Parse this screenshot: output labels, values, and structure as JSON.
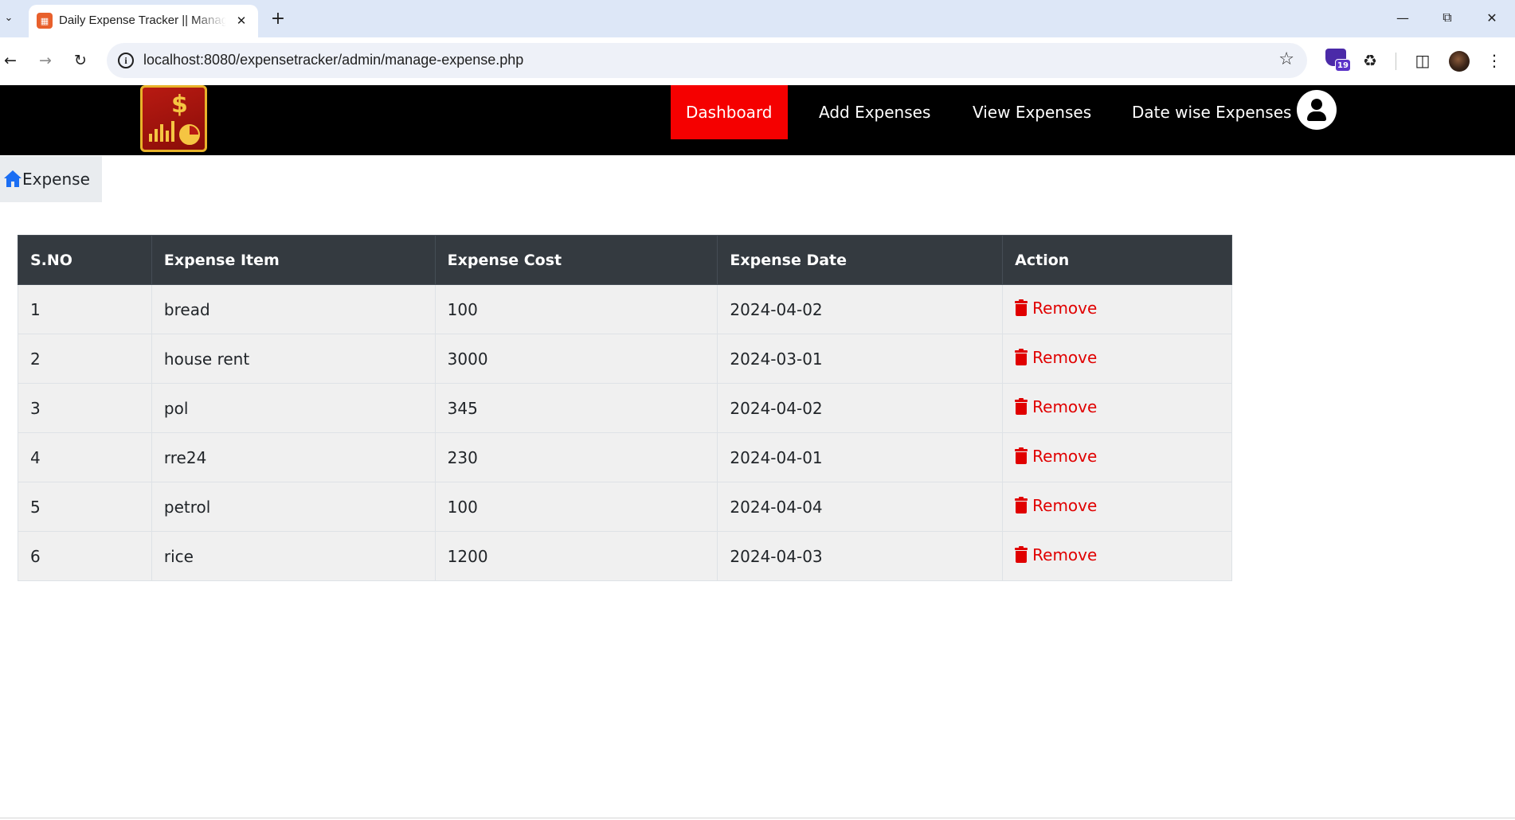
{
  "browser": {
    "tab_title": "Daily Expense Tracker || Manage Expense",
    "url": "localhost:8080/expensetracker/admin/manage-expense.php",
    "extension_badge": "19",
    "icons": [
      "tab-list-icon",
      "close-icon",
      "plus-icon",
      "minimize-icon",
      "restore-icon",
      "back-icon",
      "forward-icon",
      "reload-icon",
      "info-icon",
      "star-icon",
      "extensions-icon",
      "side-panel-icon",
      "more-icon"
    ]
  },
  "navbar": {
    "items": [
      {
        "label": "Dashboard",
        "active": true
      },
      {
        "label": "Add Expenses",
        "active": false
      },
      {
        "label": "View Expenses",
        "active": false
      },
      {
        "label": "Date wise Expenses",
        "active": false
      }
    ],
    "active_color": "#f50000"
  },
  "breadcrumb": {
    "label": "Expense"
  },
  "table": {
    "headers": [
      "S.NO",
      "Expense Item",
      "Expense Cost",
      "Expense Date",
      "Action"
    ],
    "rows": [
      {
        "sno": "1",
        "item": "bread",
        "cost": "100",
        "date": "2024-04-02",
        "action": "Remove"
      },
      {
        "sno": "2",
        "item": "house rent",
        "cost": "3000",
        "date": "2024-03-01",
        "action": "Remove"
      },
      {
        "sno": "3",
        "item": "pol",
        "cost": "345",
        "date": "2024-04-02",
        "action": "Remove"
      },
      {
        "sno": "4",
        "item": "rre24",
        "cost": "230",
        "date": "2024-04-01",
        "action": "Remove"
      },
      {
        "sno": "5",
        "item": "petrol",
        "cost": "100",
        "date": "2024-04-04",
        "action": "Remove"
      },
      {
        "sno": "6",
        "item": "rice",
        "cost": "1200",
        "date": "2024-04-03",
        "action": "Remove"
      }
    ]
  },
  "colors": {
    "header_bg": "#343a40",
    "remove": "#e00000",
    "row_bg": "#f0f0f0"
  }
}
